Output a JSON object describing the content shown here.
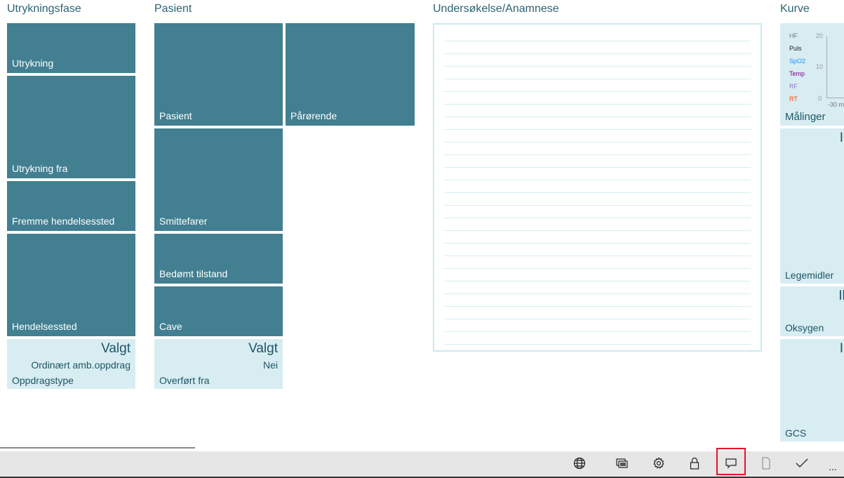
{
  "columns": {
    "c1": {
      "header": "Utrykningsfase",
      "tiles": [
        "Utrykning",
        "Utrykning fra",
        "Fremme hendelsessted",
        "Hendelsessted"
      ],
      "info": {
        "value": "Valgt",
        "sub": "Ordinært amb.oppdrag",
        "label": "Oppdragstype"
      }
    },
    "c2": {
      "header": "Pasient",
      "tiles": [
        "Pasient",
        "Pårørende",
        "Smittefarer",
        "Bedømt tilstand",
        "Cave"
      ],
      "info": {
        "value": "Valgt",
        "sub": "Nei",
        "label": "Overført fra"
      }
    },
    "c3": {
      "header": "Undersøkelse/Anamnese"
    },
    "c4": {
      "header": "Kurve",
      "chart": {
        "legend": [
          "HF",
          "Puls",
          "SpO2",
          "Temp",
          "RF",
          "RT"
        ],
        "legend_colors": [
          "#777777",
          "#222222",
          "#1e90ff",
          "#800080",
          "#9370db",
          "#ff4500"
        ],
        "yticks": [
          "20",
          "10",
          "0"
        ],
        "xtick": "-30 m",
        "label": "Målinger"
      },
      "tiles": [
        {
          "label": "Legemidler",
          "value": "I"
        },
        {
          "label": "Oksygen",
          "value": "Ik"
        },
        {
          "label": "GCS",
          "value": "I"
        }
      ]
    }
  },
  "toolbar": {
    "icons": [
      "globe-icon",
      "slideshow-icon",
      "gear-icon",
      "lock-icon",
      "comment-icon",
      "page-icon",
      "check-icon",
      "more-icon"
    ],
    "more": "...",
    "highlight": "#e81123"
  }
}
